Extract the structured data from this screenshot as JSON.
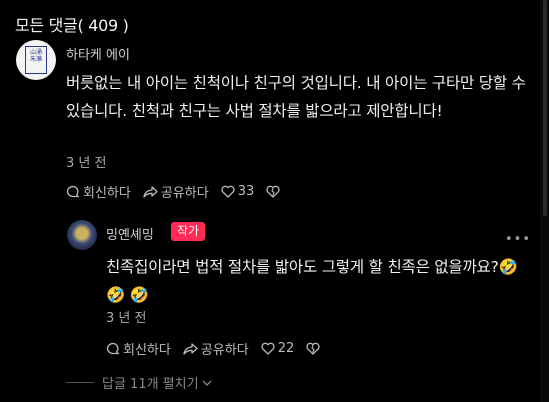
{
  "header": {
    "title": "모든 댓글( 409 )"
  },
  "comments": [
    {
      "author": "하타케 에이",
      "avatar_text": "山\n涌\n朱\n瀨",
      "text": "버릇없는 내 아이는 친척이나 친구의 것입니다. 내 아이는 구타만 당할 수 있습니다. 친척과 친구는 사법 절차를 밟으라고 제안합니다!",
      "time": "3 년 전",
      "reply_label": "회신하다",
      "share_label": "공유하다",
      "likes": "33"
    }
  ],
  "reply": {
    "author": "밍옌셰밍",
    "badge": "작가",
    "text": "친족집이라면 법적 절차를 밟아도 그렇게 할 친족은 없을까요?🤣 🤣 🤣",
    "time": "3 년 전",
    "reply_label": "회신하다",
    "share_label": "공유하다",
    "likes": "22"
  },
  "more_replies": "답글 11개 펼치기",
  "colors": {
    "background": "#000000",
    "badge": "#ff2b54",
    "text": "#f1f1f1"
  },
  "icons": [
    "comment-icon",
    "share-icon",
    "heart-icon",
    "dislike-heart-icon",
    "more-options-icon",
    "chevron-down-icon"
  ]
}
